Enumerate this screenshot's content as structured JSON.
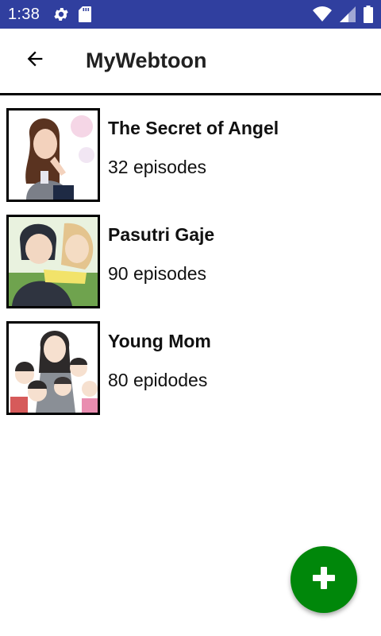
{
  "status_bar": {
    "time": "1:38",
    "icons_left": [
      "settings-icon",
      "sd-card-icon"
    ],
    "icons_right": [
      "wifi-icon",
      "signal-icon",
      "battery-icon"
    ],
    "color": "#303f9f"
  },
  "app_bar": {
    "title": "MyWebtoon",
    "back_icon": "arrow-back-icon"
  },
  "webtoons": [
    {
      "title": "The Secret of Angel",
      "subtitle": "32 episodes",
      "cover": "cover-image"
    },
    {
      "title": "Pasutri Gaje",
      "subtitle": "90 episodes",
      "cover": "cover-image"
    },
    {
      "title": "Young Mom",
      "subtitle": "80 epidodes",
      "cover": "cover-image"
    }
  ],
  "fab": {
    "icon": "plus-icon",
    "color": "#00870a"
  }
}
